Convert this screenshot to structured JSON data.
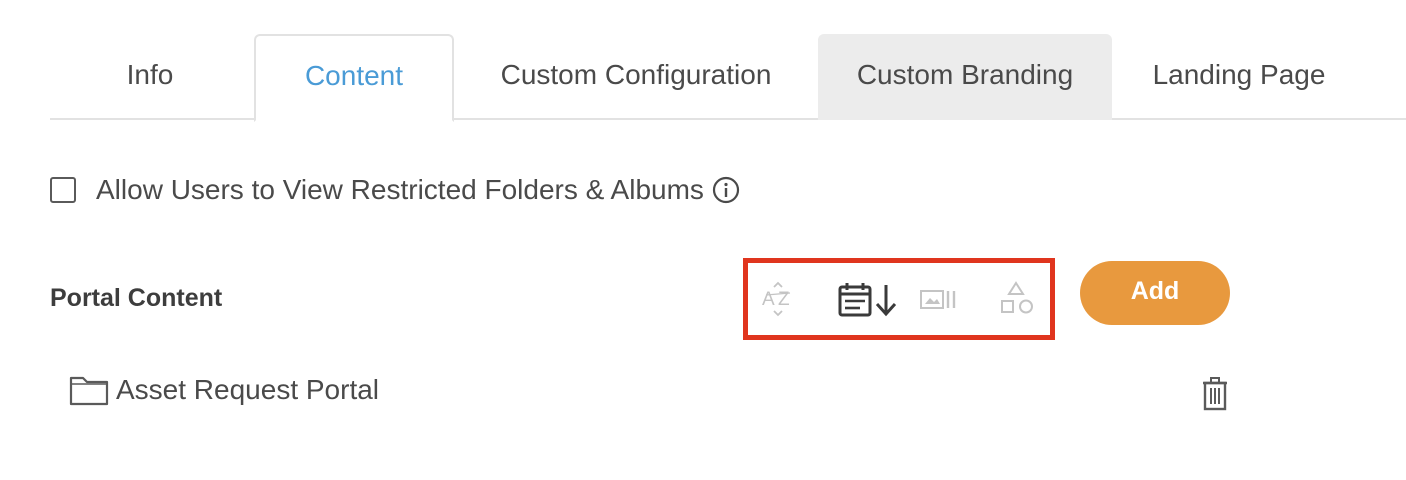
{
  "tabs": [
    {
      "label": "Info",
      "active": false
    },
    {
      "label": "Content",
      "active": true
    },
    {
      "label": "Custom Configuration",
      "active": false
    },
    {
      "label": "Custom Branding",
      "active": false,
      "hovered": true
    },
    {
      "label": "Landing Page",
      "active": false
    }
  ],
  "restricted_option": {
    "label": "Allow Users to View Restricted Folders & Albums",
    "checked": false,
    "icon": "info-icon"
  },
  "portal_content": {
    "title": "Portal Content",
    "sort_options": [
      {
        "icon": "sort-alphabetical-icon",
        "active": false
      },
      {
        "icon": "sort-by-date-icon",
        "active": true
      },
      {
        "icon": "sort-by-media-icon",
        "active": false
      },
      {
        "icon": "sort-by-type-icon",
        "active": false
      }
    ],
    "add_label": "Add",
    "items": [
      {
        "icon": "folder-icon",
        "label": "Asset Request Portal",
        "action_icon": "trash-icon"
      }
    ]
  },
  "colors": {
    "active_tab": "#4a9bd6",
    "add_button": "#e8993e",
    "highlight_border": "#e0351e",
    "hover_tab": "#ececec"
  }
}
